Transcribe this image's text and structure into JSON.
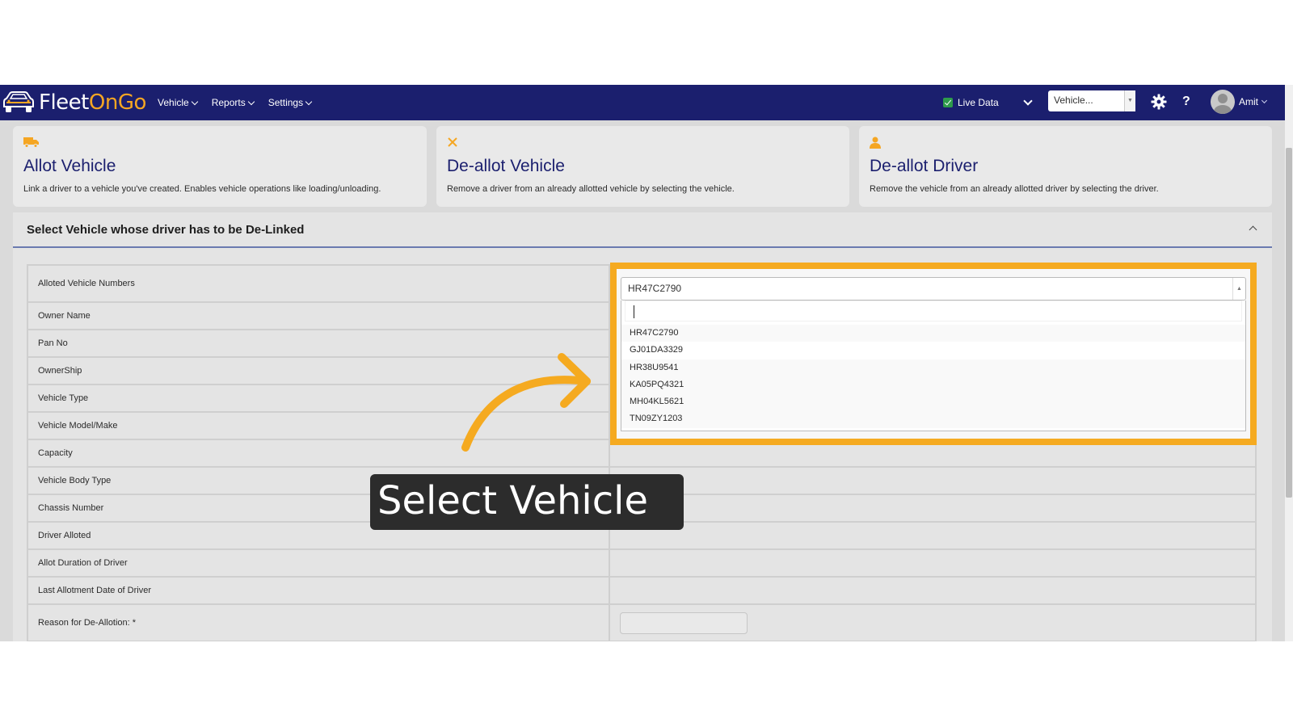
{
  "nav": {
    "brand_part1": "Fleet",
    "brand_part2": "OnGo",
    "menu": [
      {
        "label": "Vehicle"
      },
      {
        "label": "Reports"
      },
      {
        "label": "Settings"
      }
    ],
    "live_data_label": "Live Data",
    "live_data_checked": true,
    "vehicle_select_placeholder": "Vehicle...",
    "help_label": "?",
    "user_name": "Amit"
  },
  "cards": [
    {
      "icon": "truck-icon",
      "title": "Allot Vehicle",
      "description": "Link a driver to a vehicle you've created. Enables vehicle operations like loading/unloading."
    },
    {
      "icon": "close-icon",
      "title": "De-allot Vehicle",
      "description": "Remove a driver from an already allotted vehicle by selecting the vehicle."
    },
    {
      "icon": "person-icon",
      "title": "De-allot Driver",
      "description": "Remove the vehicle from an already allotted driver by selecting the driver."
    }
  ],
  "panel": {
    "title": "Select Vehicle whose driver has to be De-Linked",
    "fields": [
      "Alloted Vehicle Numbers",
      "Owner Name",
      "Pan No",
      "OwnerShip",
      "Vehicle Type",
      "Vehicle Model/Make",
      "Capacity",
      "Vehicle Body Type",
      "Chassis Number",
      "Driver Alloted",
      "Allot Duration of Driver",
      "Last Allotment Date of Driver",
      "Reason for De-Allotion: *"
    ]
  },
  "dropdown": {
    "selected": "HR47C2790",
    "search_value": "",
    "options": [
      "HR47C2790",
      "GJ01DA3329",
      "HR38U9541",
      "KA05PQ4321",
      "MH04KL5621",
      "TN09ZY1203"
    ]
  },
  "tutorial": {
    "callout_text": "Select Vehicle",
    "accent_color": "#f5aa20"
  },
  "colors": {
    "navbar": "#1b1f6e",
    "brand_accent": "#f5a623",
    "highlight": "#f5aa20"
  }
}
